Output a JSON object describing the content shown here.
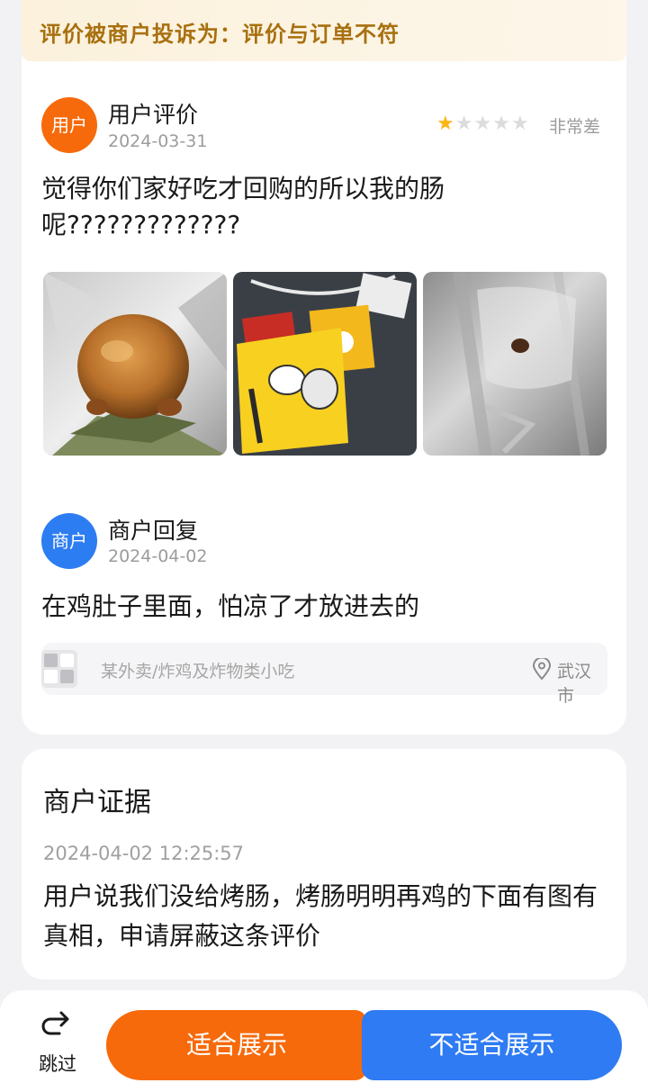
{
  "banner": {
    "text": "评价被商户投诉为：评价与订单不符"
  },
  "review": {
    "avatar_label": "用户",
    "author": "用户评价",
    "date": "2024-03-31",
    "stars_filled": 1,
    "stars_total": 5,
    "rating_label": "非常差",
    "text": "觉得你们家好吃才回购的所以我的肠呢?????????????",
    "photos": [
      "roast-chicken-photo",
      "sauce-packets-photo",
      "foil-bag-photo"
    ]
  },
  "reply": {
    "avatar_label": "商户",
    "author": "商户回复",
    "date": "2024-04-02",
    "text": "在鸡肚子里面，怕凉了才放进去的"
  },
  "store": {
    "name": "某外卖/炸鸡及炸物类小吃",
    "location": "武汉市"
  },
  "evidence": {
    "title": "商户证据",
    "time": "2024-04-02 12:25:57",
    "text": "用户说我们没给烤肠，烤肠明明再鸡的下面有图有真相，申请屏蔽这条评价"
  },
  "actions": {
    "skip_label": "跳过",
    "suitable_label": "适合展示",
    "unsuitable_label": "不适合展示"
  },
  "colors": {
    "accent_orange": "#f66a0b",
    "accent_blue": "#2e7bf3",
    "star_on": "#fbb515",
    "banner_text": "#a8700f"
  }
}
